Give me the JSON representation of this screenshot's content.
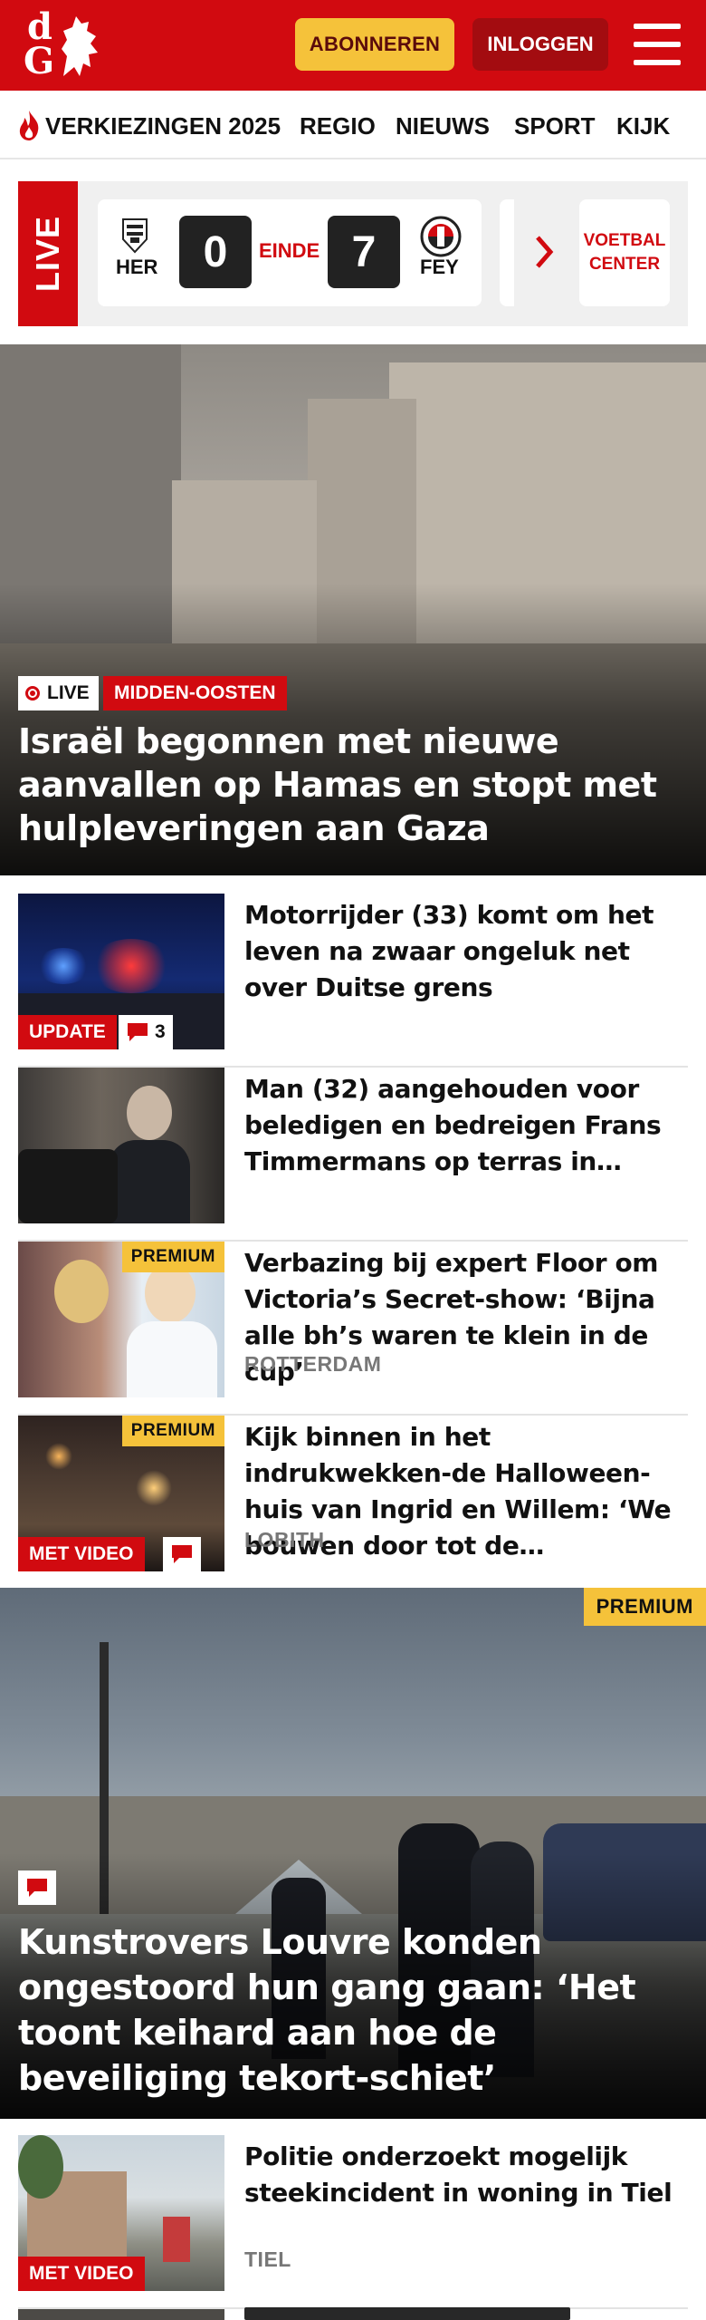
{
  "header": {
    "logo_letters": [
      "d",
      "G"
    ],
    "subscribe_label": "ABONNEREN",
    "login_label": "INLOGGEN",
    "brand_color": "#d10a10",
    "accent_color": "#f5c23a"
  },
  "nav": {
    "items": [
      "VERKIEZINGEN 2025",
      "REGIO",
      "NIEUWS",
      "SPORT",
      "KIJK"
    ]
  },
  "live": {
    "label": "LIVE",
    "match": {
      "home_team": "HER",
      "away_team": "FEY",
      "home_score": "0",
      "away_score": "7",
      "status": "EINDE"
    },
    "voetbal_center_label": "VOETBAL CENTER"
  },
  "hero": {
    "live_badge": "LIVE",
    "category": "MIDDEN-OOSTEN",
    "title": "Israël begonnen met nieuwe aanvallen op Hamas en stopt met hulpleveringen aan Gaza"
  },
  "articles": [
    {
      "title": "Motorrijder (33) komt om het leven na zwaar ongeluk net over Duitse grens",
      "tag": "UPDATE",
      "comments": "3",
      "location": ""
    },
    {
      "title": "Man (32) aangehouden voor beledigen en bedreigen Frans Timmermans op terras in…",
      "location": ""
    },
    {
      "title": "Verbazing bij expert Floor om Victoria’s Secret-show: ‘Bijna alle bh’s waren te klein in de cup’",
      "premium": "PREMIUM",
      "location": "ROTTERDAM"
    },
    {
      "title": "Kijk binnen in het indrukwekken-de Halloween-huis van Ingrid en Willem: ‘We bouwen door tot de…",
      "premium": "PREMIUM",
      "tag": "MET VIDEO",
      "location": "LOBITH"
    }
  ],
  "hero2": {
    "premium": "PREMIUM",
    "title": "Kunstrovers Louvre konden ongestoord hun gang gaan: ‘Het toont keihard aan hoe de beveiliging tekort-schiet’"
  },
  "articles2": [
    {
      "title": "Politie onderzoekt mogelijk steekincident in woning in Tiel",
      "tag": "MET VIDEO",
      "location": "TIEL"
    }
  ]
}
